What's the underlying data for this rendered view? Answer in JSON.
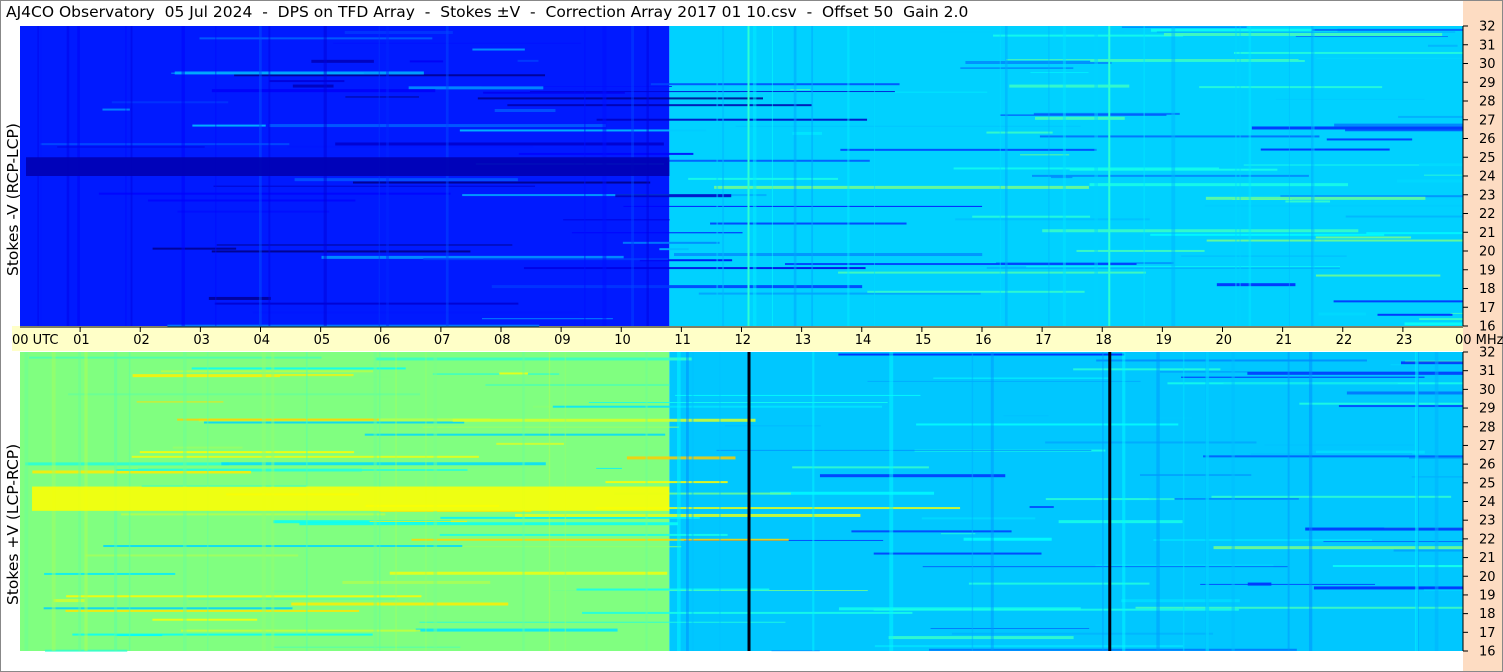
{
  "title": "AJ4CO Observatory  05 Jul 2024  -  DPS on TFD Array  -  Stokes ±V  -  Correction Array 2017 01 10.csv  -  Offset 50  Gain 2.0",
  "colors": {
    "background": "#ffffff",
    "time_band": "#ffffc8",
    "right_strip": "#fddcc2"
  },
  "chart_data": [
    {
      "type": "heatmap",
      "ylabel": "Stokes -V (RCP-LCP)",
      "x_label_start": "00 UTC",
      "x_label_end": "00 MHz",
      "x_ticks": [
        "01",
        "02",
        "03",
        "04",
        "05",
        "06",
        "07",
        "08",
        "09",
        "10",
        "11",
        "12",
        "13",
        "14",
        "15",
        "16",
        "17",
        "18",
        "19",
        "20",
        "21",
        "22",
        "23"
      ],
      "y_ticks": [
        "32",
        "31",
        "30",
        "29",
        "28",
        "27",
        "26",
        "25",
        "24",
        "23",
        "22",
        "21",
        "20",
        "19",
        "18",
        "17",
        "16"
      ],
      "xlim_utc_hours": [
        0,
        24
      ],
      "ylim_mhz": [
        16,
        32
      ],
      "colormap": "jet",
      "regions": [
        {
          "utc_from": 0,
          "utc_to": 10.8,
          "level": 0.15
        },
        {
          "utc_from": 10.8,
          "utc_to": 24,
          "level": 0.33
        }
      ],
      "bright_lines_utc": [
        12.1,
        18.1
      ]
    },
    {
      "type": "heatmap",
      "ylabel": "Stokes +V (LCP-RCP)",
      "y_ticks": [
        "32",
        "31",
        "30",
        "29",
        "28",
        "27",
        "26",
        "25",
        "24",
        "23",
        "22",
        "21",
        "20",
        "19",
        "18",
        "17",
        "16"
      ],
      "xlim_utc_hours": [
        0,
        24
      ],
      "ylim_mhz": [
        16,
        32
      ],
      "colormap": "jet",
      "regions": [
        {
          "utc_from": 0,
          "utc_to": 10.8,
          "level": 0.5
        },
        {
          "utc_from": 10.8,
          "utc_to": 24,
          "level": 0.32
        }
      ],
      "dark_lines_utc": [
        12.1,
        18.1
      ]
    }
  ]
}
